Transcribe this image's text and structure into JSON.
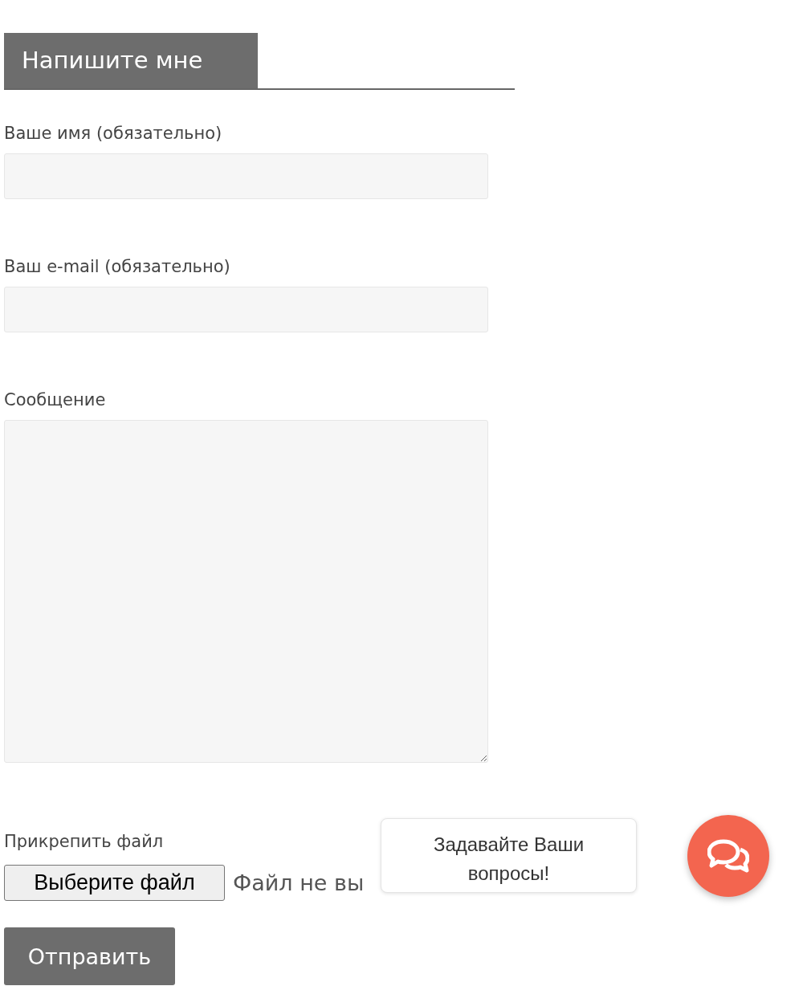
{
  "heading": "Напишите мне",
  "fields": [
    {
      "label": "Ваше имя (обязательно)",
      "kind": "input"
    },
    {
      "label": "Ваш e-mail (обязательно)",
      "kind": "input"
    },
    {
      "label": "Сообщение",
      "kind": "textarea"
    }
  ],
  "attachment": {
    "label": "Прикрепить файл",
    "button": "Выберите файл",
    "status": "Файл не вы"
  },
  "submit": "Отправить",
  "chat_widget": {
    "tooltip": "Задавайте Ваши вопросы!"
  }
}
